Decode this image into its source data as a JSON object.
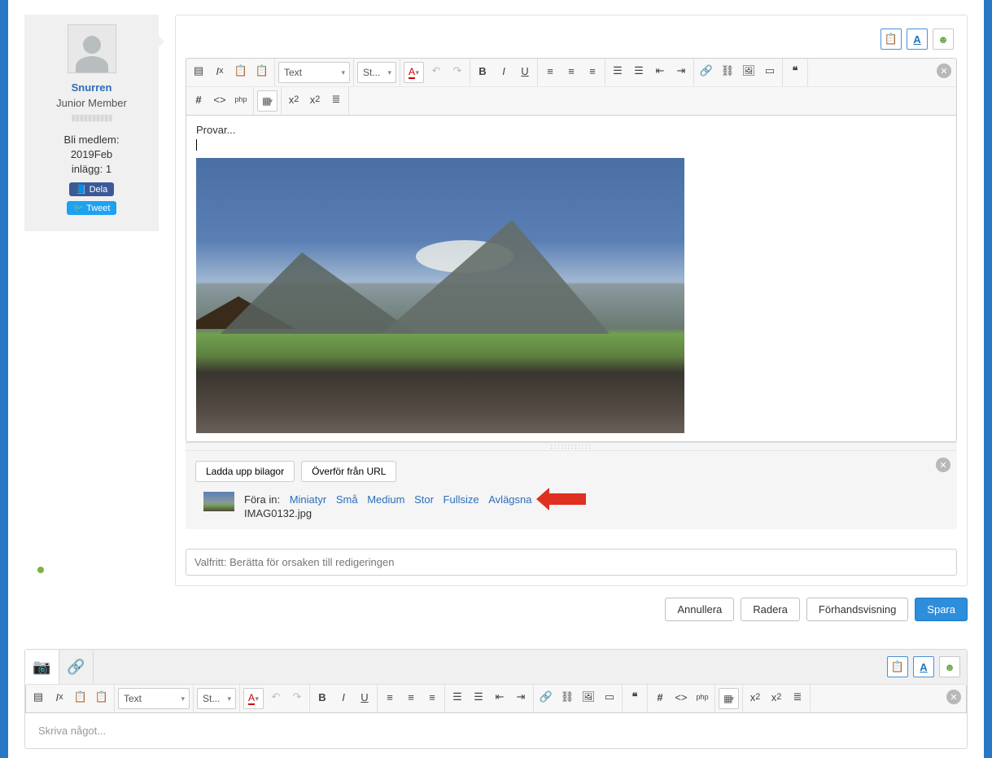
{
  "user": {
    "name": "Snurren",
    "rank": "Junior Member",
    "join_label": "Bli medlem:",
    "join_date": "2019Feb",
    "posts_label": "inlägg:",
    "posts_count": "1",
    "share_fb": "Dela",
    "share_tw": "Tweet"
  },
  "editor": {
    "text_select": "Text",
    "style_select": "St...",
    "content_text": "Provar...",
    "color_letter": "A"
  },
  "attach": {
    "upload_btn": "Ladda upp bilagor",
    "url_btn": "Överför från URL",
    "insert_label": "Föra in:",
    "sizes": {
      "mini": "Miniatyr",
      "small": "Små",
      "medium": "Medium",
      "large": "Stor",
      "full": "Fullsize",
      "remove": "Avlägsna"
    },
    "filename": "IMAG0132.jpg"
  },
  "reason_placeholder": "Valfritt: Berätta för orsaken till redigeringen",
  "actions": {
    "cancel": "Annullera",
    "delete": "Radera",
    "preview": "Förhandsvisning",
    "save": "Spara"
  },
  "reply": {
    "text_select": "Text",
    "style_select": "St...",
    "placeholder": "Skriva något..."
  }
}
